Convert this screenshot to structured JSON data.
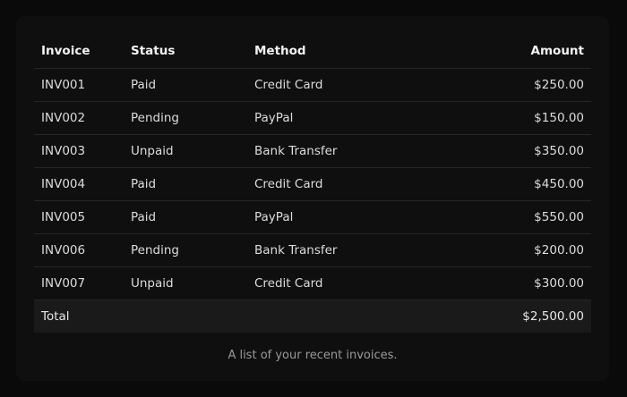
{
  "table": {
    "headers": {
      "invoice": "Invoice",
      "status": "Status",
      "method": "Method",
      "amount": "Amount"
    },
    "rows": [
      {
        "invoice": "INV001",
        "status": "Paid",
        "method": "Credit Card",
        "amount": "$250.00"
      },
      {
        "invoice": "INV002",
        "status": "Pending",
        "method": "PayPal",
        "amount": "$150.00"
      },
      {
        "invoice": "INV003",
        "status": "Unpaid",
        "method": "Bank Transfer",
        "amount": "$350.00"
      },
      {
        "invoice": "INV004",
        "status": "Paid",
        "method": "Credit Card",
        "amount": "$450.00"
      },
      {
        "invoice": "INV005",
        "status": "Paid",
        "method": "PayPal",
        "amount": "$550.00"
      },
      {
        "invoice": "INV006",
        "status": "Pending",
        "method": "Bank Transfer",
        "amount": "$200.00"
      },
      {
        "invoice": "INV007",
        "status": "Unpaid",
        "method": "Credit Card",
        "amount": "$300.00"
      }
    ],
    "footer": {
      "label": "Total",
      "amount": "$2,500.00"
    },
    "caption": "A list of your recent invoices."
  }
}
